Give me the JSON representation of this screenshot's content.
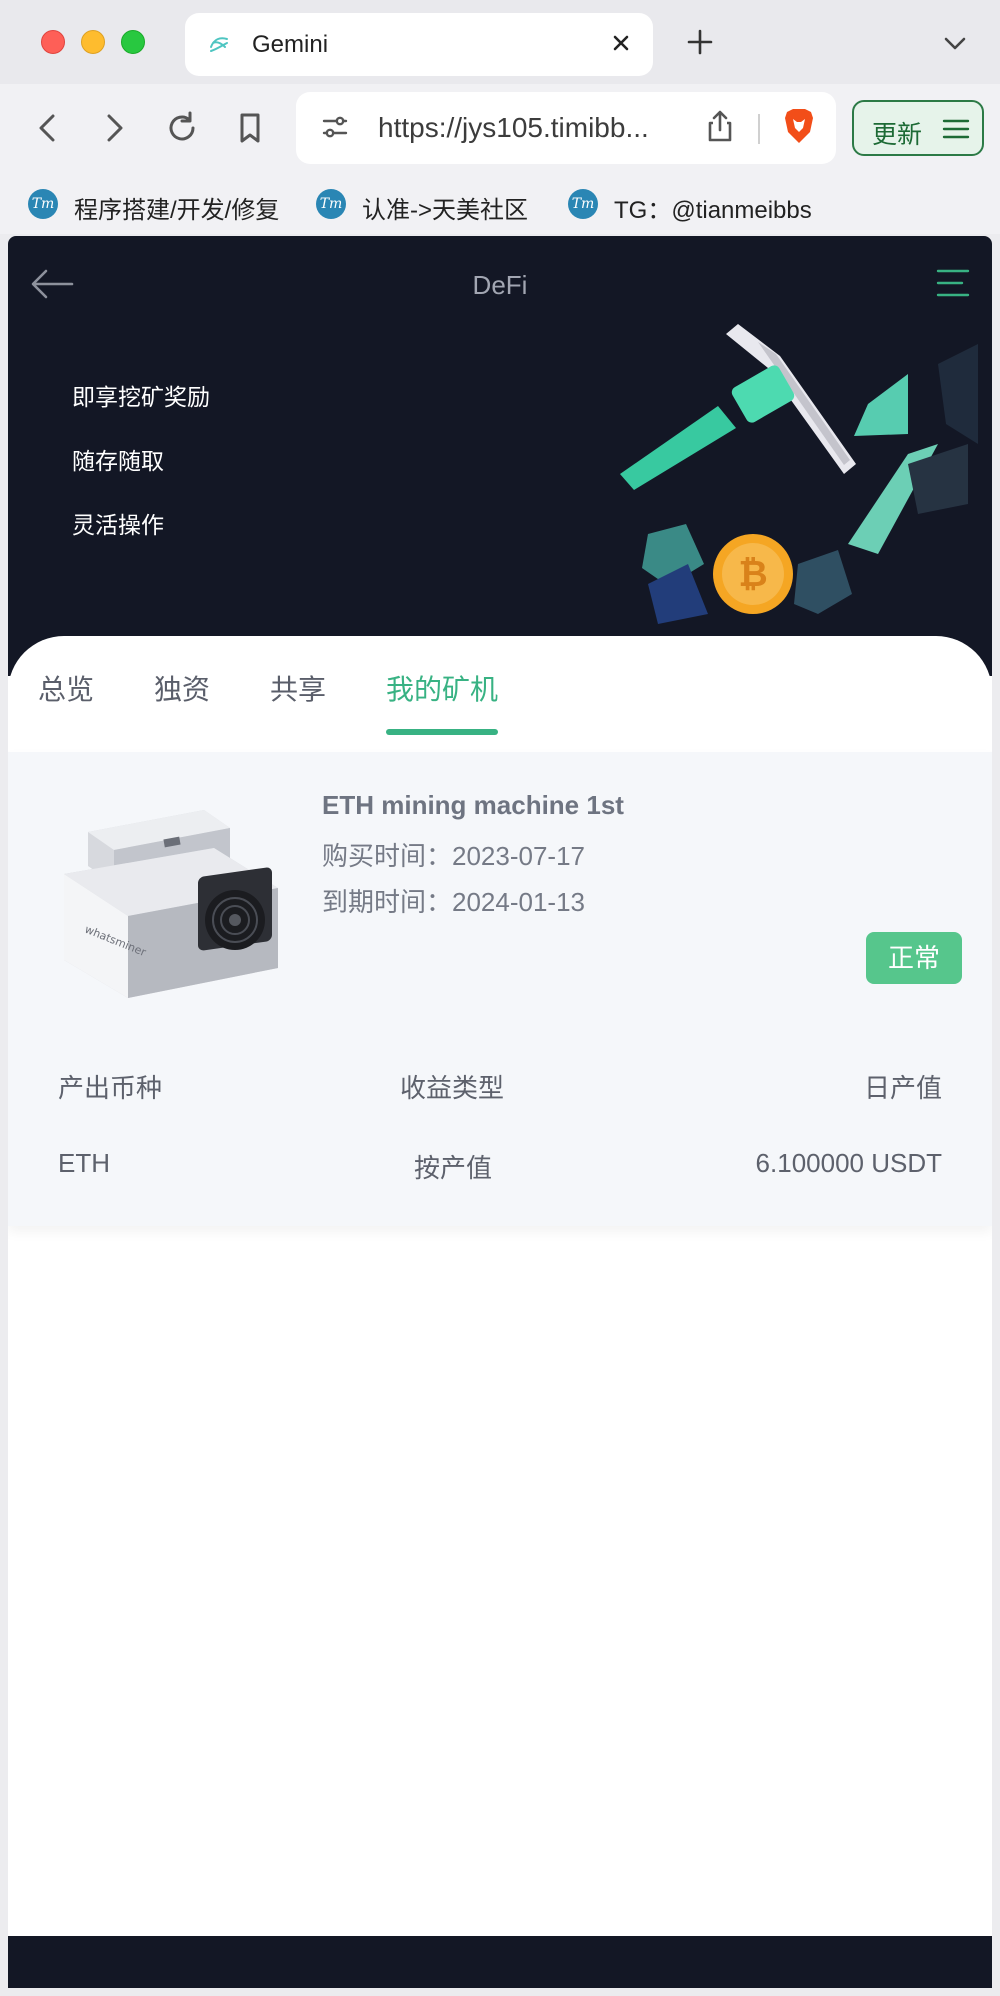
{
  "browser": {
    "tab_title": "Gemini",
    "url": "https://jys105.timibb...",
    "update_label": "更新",
    "bookmarks": [
      {
        "label": "程序搭建/开发/修复",
        "icon": "tm"
      },
      {
        "label": "认准->天美社区",
        "icon": "tm"
      },
      {
        "label": "TG：@tianmeibbs",
        "icon": "tm"
      }
    ]
  },
  "header": {
    "title": "DeFi"
  },
  "hero": {
    "slogans": [
      "即享挖矿奖励",
      "随存随取",
      "灵活操作"
    ]
  },
  "tabs": [
    {
      "label": "总览",
      "active": false
    },
    {
      "label": "独资",
      "active": false
    },
    {
      "label": "共享",
      "active": false
    },
    {
      "label": "我的矿机",
      "active": true
    }
  ],
  "machine": {
    "name": "ETH mining machine 1st",
    "purchase_time": "购买时间：2023-07-17",
    "expire_time": "到期时间：2024-01-13",
    "status": "正常",
    "columns": [
      "产出币种",
      "收益类型",
      "日产值"
    ],
    "values": [
      "ETH",
      "按产值",
      "6.100000 USDT"
    ]
  },
  "colors": {
    "accent": "#38b283",
    "dark_bg": "#131725",
    "status_green": "#56c68c"
  }
}
